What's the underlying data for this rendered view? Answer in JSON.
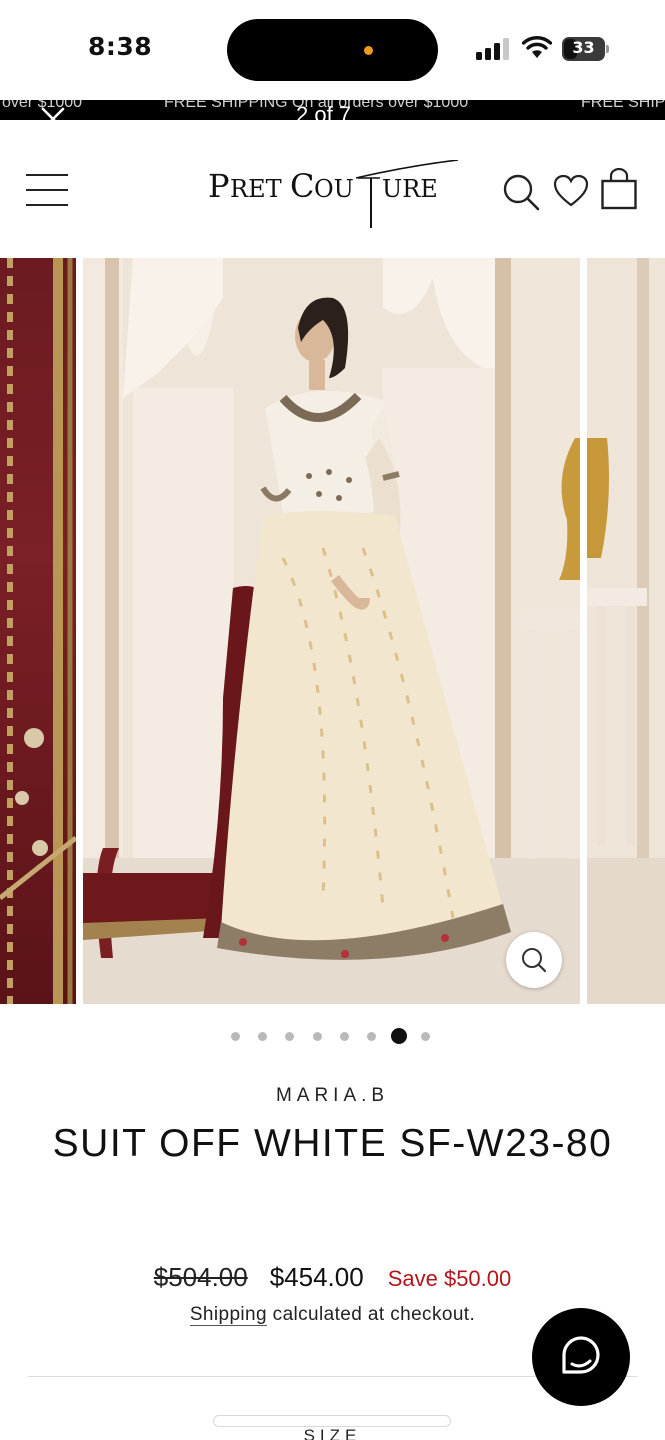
{
  "status_bar": {
    "time": "8:38",
    "battery": "33",
    "icons": [
      "cellular-signal-icon",
      "wifi-icon",
      "battery-icon"
    ],
    "battery_level": 0.33,
    "accent_dot_color": "#f39a1b"
  },
  "announcement": {
    "items": [
      "over $1000",
      "FREE SHIPPING On all orders over $1000",
      "FREE SHIP"
    ]
  },
  "gallery_overlay": {
    "counter": "2 of 7",
    "close_icon": "close-icon"
  },
  "header": {
    "logo_text": "PRET COUTURE",
    "icons": [
      "menu-icon",
      "search-icon",
      "heart-icon",
      "cart-icon"
    ]
  },
  "gallery": {
    "dots_total": 8,
    "active_dot_index": 6,
    "zoom_icon": "magnify-icon"
  },
  "product": {
    "brand": "MARIA.B",
    "title": "SUIT OFF WHITE SF-W23-80",
    "price_compare": "$504.00",
    "price": "$454.00",
    "savings": "Save $50.00",
    "shipping_link": "Shipping",
    "shipping_rest": " calculated at checkout.",
    "size_label": "SIZE"
  },
  "colors": {
    "sale": "#b3161b",
    "announcement_bg": "#000000",
    "chat_button": "#000000"
  }
}
